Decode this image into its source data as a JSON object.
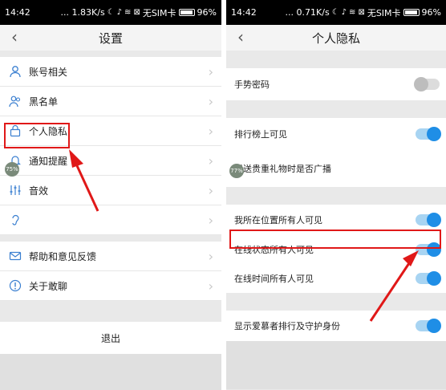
{
  "left": {
    "status": {
      "time": "14:42",
      "speed": "... 1.83K/s",
      "sim": "无SIM卡",
      "battery": "96%"
    },
    "nav": {
      "title": "设置"
    },
    "items": [
      {
        "label": "账号相关",
        "icon": "user-icon"
      },
      {
        "label": "黑名单",
        "icon": "users-icon"
      },
      {
        "label": "个人隐私",
        "icon": "lock-icon"
      },
      {
        "label": "通知提醒",
        "icon": "bell-icon"
      },
      {
        "label": "音效",
        "icon": "sliders-icon"
      },
      {
        "label": "",
        "icon": "ear-icon"
      },
      {
        "label": "帮助和意见反馈",
        "icon": "mail-icon"
      },
      {
        "label": "关于敢聊",
        "icon": "info-icon"
      }
    ],
    "logout": "退出",
    "badge": "75%"
  },
  "right": {
    "status": {
      "time": "14:42",
      "speed": "... 0.71K/s",
      "sim": "无SIM卡",
      "battery": "96%"
    },
    "nav": {
      "title": "个人隐私"
    },
    "settings": [
      {
        "label": "手势密码",
        "on": false
      },
      {
        "label": "排行榜上可见",
        "on": true
      },
      {
        "label": "赠送贵重礼物时是否广播",
        "on": true
      },
      {
        "label": "我所在位置所有人可见",
        "on": true
      },
      {
        "label": "在线状态所有人可见",
        "on": true
      },
      {
        "label": "在线时间所有人可见",
        "on": true
      },
      {
        "label": "显示爱慕者排行及守护身份",
        "on": true
      }
    ],
    "badge": "77%"
  },
  "colors": {
    "accent": "#1f8ee6",
    "highlight": "#e01818"
  }
}
